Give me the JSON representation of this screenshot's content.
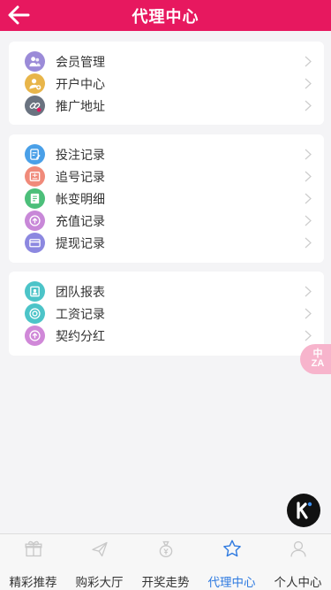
{
  "header": {
    "title": "代理中心"
  },
  "groups": [
    {
      "items": [
        {
          "label": "会员管理",
          "icon": "members-icon",
          "color": "#9b8bd8"
        },
        {
          "label": "开户中心",
          "icon": "add-account-icon",
          "color": "#e8b54a"
        },
        {
          "label": "推广地址",
          "icon": "link-icon",
          "color": "#6a7380"
        }
      ]
    },
    {
      "items": [
        {
          "label": "投注记录",
          "icon": "bet-record-icon",
          "color": "#4aa0e8"
        },
        {
          "label": "追号记录",
          "icon": "chase-record-icon",
          "color": "#f08a7a"
        },
        {
          "label": "帐变明细",
          "icon": "account-change-icon",
          "color": "#4cbf7a"
        },
        {
          "label": "充值记录",
          "icon": "deposit-icon",
          "color": "#c888d8"
        },
        {
          "label": "提现记录",
          "icon": "withdraw-icon",
          "color": "#8c88e0"
        }
      ]
    },
    {
      "items": [
        {
          "label": "团队报表",
          "icon": "team-report-icon",
          "color": "#4cc4c8"
        },
        {
          "label": "工资记录",
          "icon": "salary-icon",
          "color": "#4cc4c8"
        },
        {
          "label": "契约分红",
          "icon": "dividend-icon",
          "color": "#d088d8"
        }
      ]
    }
  ],
  "floating": {
    "lang_label_top": "中",
    "lang_label_bottom": "ZA"
  },
  "tabbar": {
    "tabs": [
      {
        "label": "精彩推荐",
        "icon": "gift-icon",
        "active": false
      },
      {
        "label": "购彩大厅",
        "icon": "plane-icon",
        "active": false
      },
      {
        "label": "开奖走势",
        "icon": "money-bag-icon",
        "active": false
      },
      {
        "label": "代理中心",
        "icon": "star-icon",
        "active": true
      },
      {
        "label": "个人中心",
        "icon": "user-icon",
        "active": false
      }
    ],
    "active_color": "#2e7ae0",
    "inactive_icon_color": "#c8c8c8"
  },
  "colors": {
    "brand": "#e7185f",
    "background": "#f4f4f6"
  }
}
